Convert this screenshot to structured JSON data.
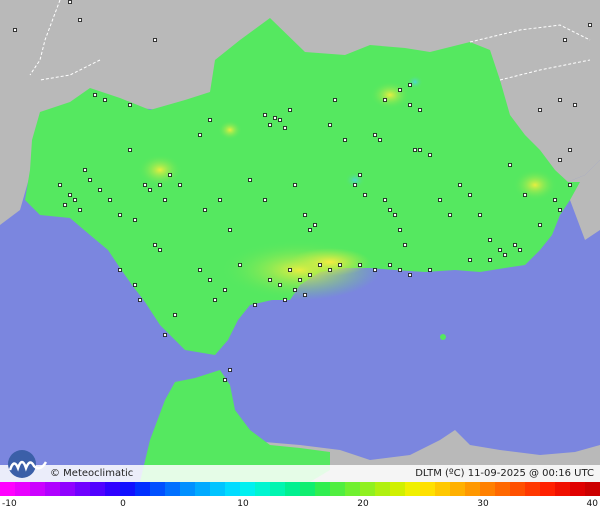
{
  "map": {
    "colors": {
      "sea": "#7b86df",
      "land_outside": "#b9b9b9",
      "land_main": "#55e860",
      "warm_zone": "#c9ec46",
      "hot_zone": "#f2f043",
      "cool_spot": "#55d9c8",
      "stations": "#111111"
    }
  },
  "footer": {
    "logo_text": "© Meteoclimatic",
    "info_text": "DLTM (ºC)  11-09-2025 @ 00:16 UTC",
    "logo_icon": "meteoclimatic-logo-icon"
  },
  "scale": {
    "ticks": [
      "-10",
      "0",
      "10",
      "20",
      "30",
      "40"
    ],
    "colors": [
      "#ff00ff",
      "#e800ff",
      "#cc00ff",
      "#b000ff",
      "#9000ff",
      "#7000ff",
      "#5000ff",
      "#3000ff",
      "#1010ff",
      "#0030ff",
      "#0050ff",
      "#0070ff",
      "#0090ff",
      "#00aaff",
      "#00c4ff",
      "#00dcff",
      "#00f0f0",
      "#00f5d0",
      "#00f5b0",
      "#00f090",
      "#10ee70",
      "#30ee50",
      "#50ee40",
      "#70f030",
      "#90f020",
      "#b0f010",
      "#d0f000",
      "#f0f000",
      "#ffe000",
      "#ffc800",
      "#ffb000",
      "#ff9800",
      "#ff8000",
      "#ff6800",
      "#ff5000",
      "#ff3800",
      "#ff2000",
      "#f01000",
      "#e00000",
      "#cc0000"
    ]
  }
}
